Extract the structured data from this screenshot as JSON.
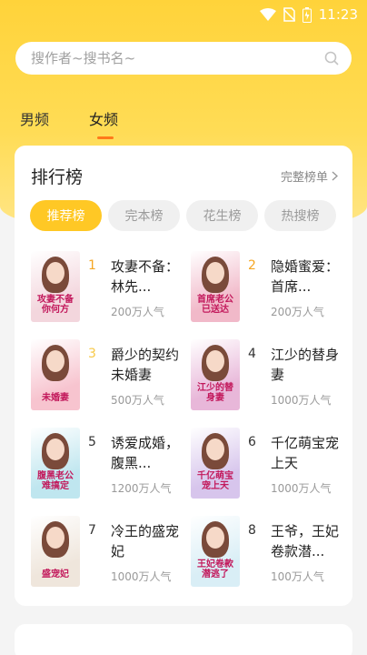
{
  "status_bar": {
    "time": "11:23"
  },
  "search": {
    "placeholder": "搜作者~搜书名~"
  },
  "tabs": [
    {
      "label": "男频",
      "active": false
    },
    {
      "label": "女频",
      "active": true
    }
  ],
  "ranking": {
    "title": "排行榜",
    "full_list": "完整榜单",
    "pills": [
      {
        "label": "推荐榜",
        "active": true
      },
      {
        "label": "完本榜",
        "active": false
      },
      {
        "label": "花生榜",
        "active": false
      },
      {
        "label": "热搜榜",
        "active": false
      }
    ],
    "books": [
      {
        "rank": "1",
        "title": "攻妻不备：林先...",
        "popularity": "200万人气",
        "cover_text": "攻妻不备 你何方",
        "cover_color": "#f3d6dd"
      },
      {
        "rank": "2",
        "title": "隐婚蜜爱：首席...",
        "popularity": "200万人气",
        "cover_text": "首席老公 已送达",
        "cover_color": "#f1b9c9"
      },
      {
        "rank": "3",
        "title": "爵少的契约未婚妻",
        "popularity": "500万人气",
        "cover_text": "未婚妻",
        "cover_color": "#f7c4cf"
      },
      {
        "rank": "4",
        "title": "江少的替身妻",
        "popularity": "1000万人气",
        "cover_text": "江少的替身妻",
        "cover_color": "#e8b7d9"
      },
      {
        "rank": "5",
        "title": "诱爱成婚，腹黑...",
        "popularity": "1200万人气",
        "cover_text": "腹黑老公 难搞定",
        "cover_color": "#bfe6ef"
      },
      {
        "rank": "6",
        "title": "千亿萌宝宠上天",
        "popularity": "1000万人气",
        "cover_text": "千亿萌宝 宠上天",
        "cover_color": "#d7c5ec"
      },
      {
        "rank": "7",
        "title": "冷王的盛宠妃",
        "popularity": "1000万人气",
        "cover_text": "盛宠妃",
        "cover_color": "#efe6dc"
      },
      {
        "rank": "8",
        "title": "王爷，王妃卷款潜...",
        "popularity": "100万人气",
        "cover_text": "王妃卷款 潜逃了",
        "cover_color": "#d9eef6"
      }
    ]
  }
}
